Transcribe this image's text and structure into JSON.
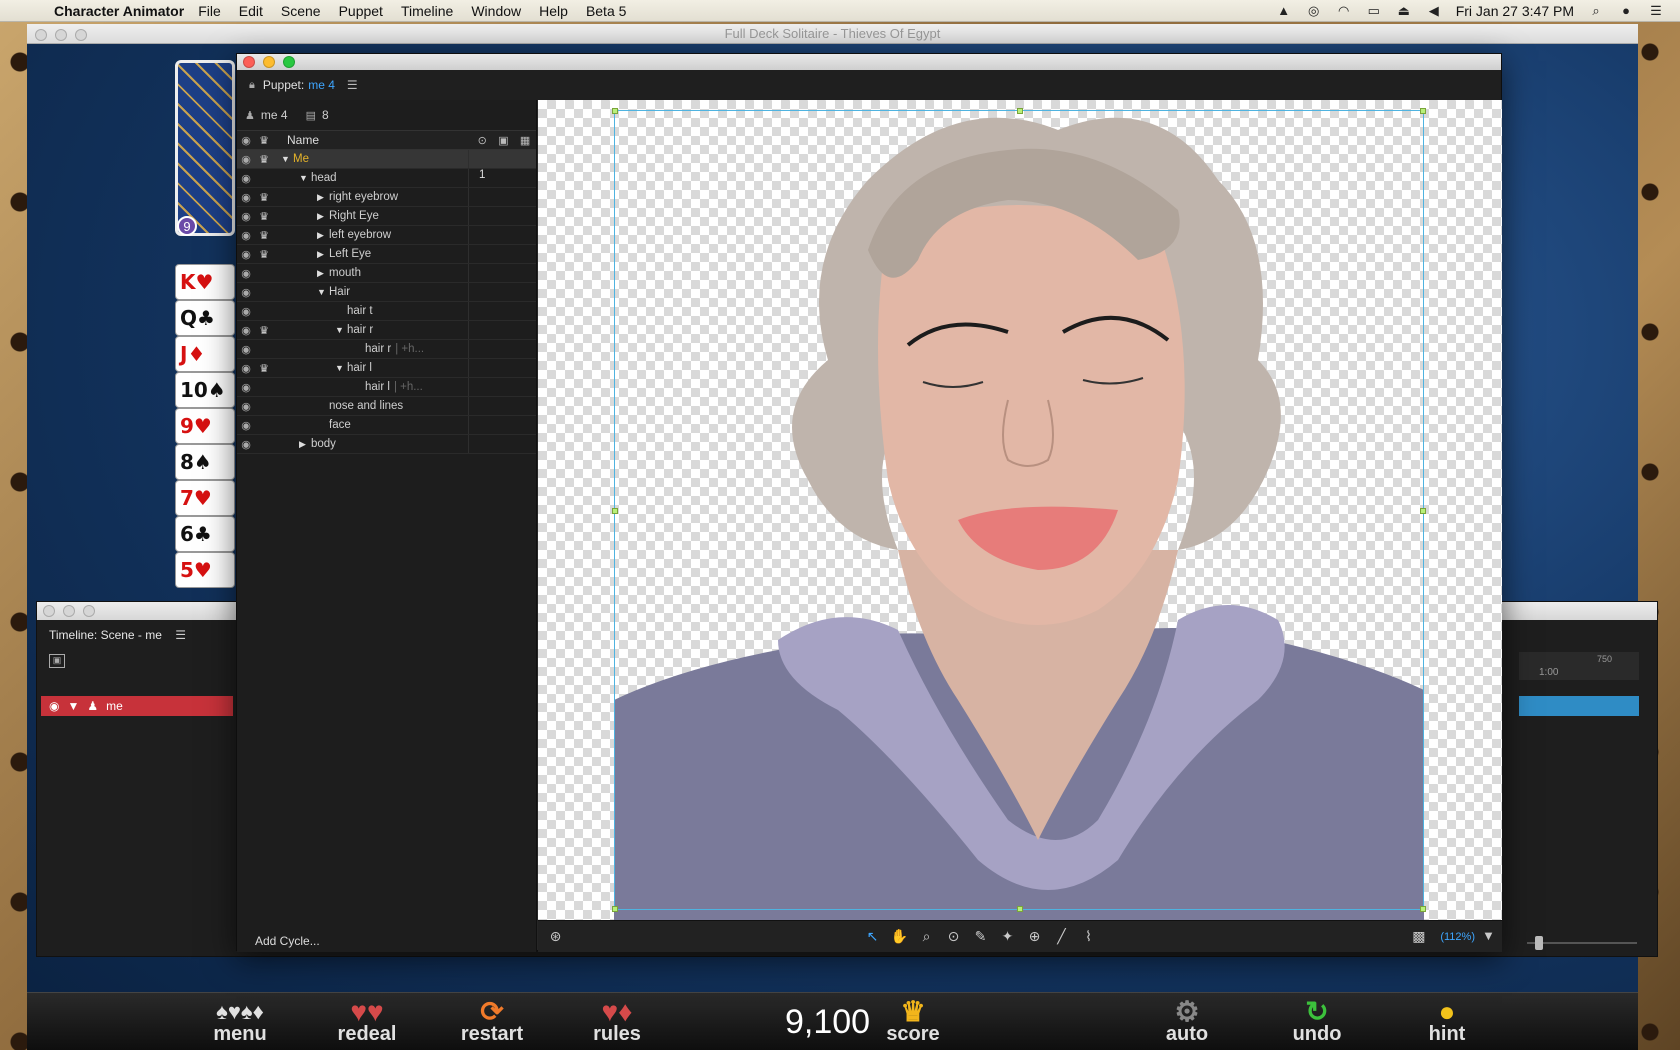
{
  "menubar": {
    "app_name": "Character Animator",
    "items": [
      "File",
      "Edit",
      "Scene",
      "Puppet",
      "Timeline",
      "Window",
      "Help",
      "Beta 5"
    ],
    "clock": "Fri Jan 27  3:47 PM"
  },
  "solitaire": {
    "window_title": "Full Deck Solitaire - Thieves Of Egypt",
    "stock_count": "9",
    "column_cards": [
      {
        "text": "K♥",
        "color": "red"
      },
      {
        "text": "Q♣",
        "color": "black"
      },
      {
        "text": "J♦",
        "color": "red"
      },
      {
        "text": "10♠",
        "color": "black"
      },
      {
        "text": "9♥",
        "color": "red"
      },
      {
        "text": "8♠",
        "color": "black"
      },
      {
        "text": "7♥",
        "color": "red"
      },
      {
        "text": "6♣",
        "color": "black"
      },
      {
        "text": "5♥",
        "color": "red"
      }
    ],
    "toolbar": {
      "menu": "menu",
      "redeal": "redeal",
      "restart": "restart",
      "rules": "rules",
      "score_value": "9,100",
      "score": "score",
      "auto": "auto",
      "undo": "undo",
      "hint": "hint"
    }
  },
  "timeline": {
    "title": "Timeline: Scene - me",
    "track_name": "me",
    "ruler_labels": [
      "1:00",
      "750"
    ]
  },
  "puppet": {
    "panel_label": "Puppet:",
    "puppet_name": "me 4",
    "info_name": "me 4",
    "info_count": "8",
    "header_name": "Name",
    "add_cycle": "Add Cycle...",
    "zoom": "(112%)",
    "layers": [
      {
        "name": "Me",
        "indent": 0,
        "arrow": "down",
        "crown": true,
        "selected": true,
        "col2": ""
      },
      {
        "name": "head",
        "indent": 1,
        "arrow": "down",
        "crown": false,
        "selected": false,
        "col2": "1"
      },
      {
        "name": "right eyebrow",
        "indent": 2,
        "arrow": "right",
        "crown": true,
        "selected": false,
        "col2": ""
      },
      {
        "name": "Right Eye",
        "indent": 2,
        "arrow": "right",
        "crown": true,
        "selected": false,
        "col2": ""
      },
      {
        "name": "left eyebrow",
        "indent": 2,
        "arrow": "right",
        "crown": true,
        "selected": false,
        "col2": ""
      },
      {
        "name": "Left Eye",
        "indent": 2,
        "arrow": "right",
        "crown": true,
        "selected": false,
        "col2": ""
      },
      {
        "name": "mouth",
        "indent": 2,
        "arrow": "right",
        "crown": false,
        "selected": false,
        "col2": ""
      },
      {
        "name": "Hair",
        "indent": 2,
        "arrow": "down",
        "crown": false,
        "selected": false,
        "col2": ""
      },
      {
        "name": "hair t",
        "indent": 3,
        "arrow": "",
        "crown": false,
        "selected": false,
        "col2": ""
      },
      {
        "name": "hair r",
        "indent": 3,
        "arrow": "down",
        "crown": true,
        "selected": false,
        "col2": ""
      },
      {
        "name": "hair r",
        "indent": 4,
        "arrow": "",
        "crown": false,
        "selected": false,
        "col2": "",
        "suffix": "| +h..."
      },
      {
        "name": "hair l",
        "indent": 3,
        "arrow": "down",
        "crown": true,
        "selected": false,
        "col2": ""
      },
      {
        "name": "hair l",
        "indent": 4,
        "arrow": "",
        "crown": false,
        "selected": false,
        "col2": "",
        "suffix": "| +h..."
      },
      {
        "name": "nose and lines",
        "indent": 2,
        "arrow": "",
        "crown": false,
        "selected": false,
        "col2": ""
      },
      {
        "name": "face",
        "indent": 2,
        "arrow": "",
        "crown": false,
        "selected": false,
        "col2": ""
      },
      {
        "name": "body",
        "indent": 1,
        "arrow": "right",
        "crown": false,
        "selected": false,
        "col2": ""
      }
    ]
  },
  "colors": {
    "accent_blue": "#3ea6ff",
    "selected_layer_text": "#e6b42a",
    "timeline_track": "#c7323a"
  }
}
